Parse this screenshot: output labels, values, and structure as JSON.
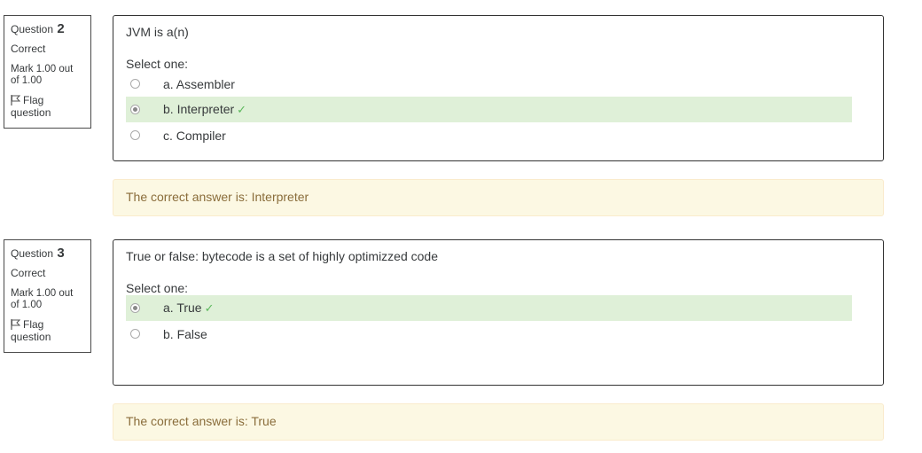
{
  "questions": [
    {
      "label": "Question",
      "number": "2",
      "state": "Correct",
      "grade": "Mark 1.00 out of 1.00",
      "flag": "Flag question",
      "text": "JVM is a(n)",
      "prompt": "Select one:",
      "options": [
        {
          "label": "a. Assembler",
          "checked": false,
          "correct": false
        },
        {
          "label": "b. Interpreter",
          "checked": true,
          "correct": true
        },
        {
          "label": "c. Compiler",
          "checked": false,
          "correct": false
        }
      ],
      "feedback": "The correct answer is: Interpreter"
    },
    {
      "label": "Question",
      "number": "3",
      "state": "Correct",
      "grade": "Mark 1.00 out of 1.00",
      "flag": "Flag question",
      "text": "True or false: bytecode is a set of highly optimizzed code",
      "prompt": "Select one:",
      "options": [
        {
          "label": "a. True",
          "checked": true,
          "correct": true
        },
        {
          "label": "b. False",
          "checked": false,
          "correct": false
        }
      ],
      "feedback": "The correct answer is: True"
    }
  ],
  "icons": {
    "flag": "flag-icon",
    "correct": "check-icon"
  },
  "colors": {
    "correct_bg": "#dff0d8",
    "feedback_bg": "#fcf8e3",
    "feedback_text": "#8a6d3b",
    "tick": "#5cb85c"
  }
}
